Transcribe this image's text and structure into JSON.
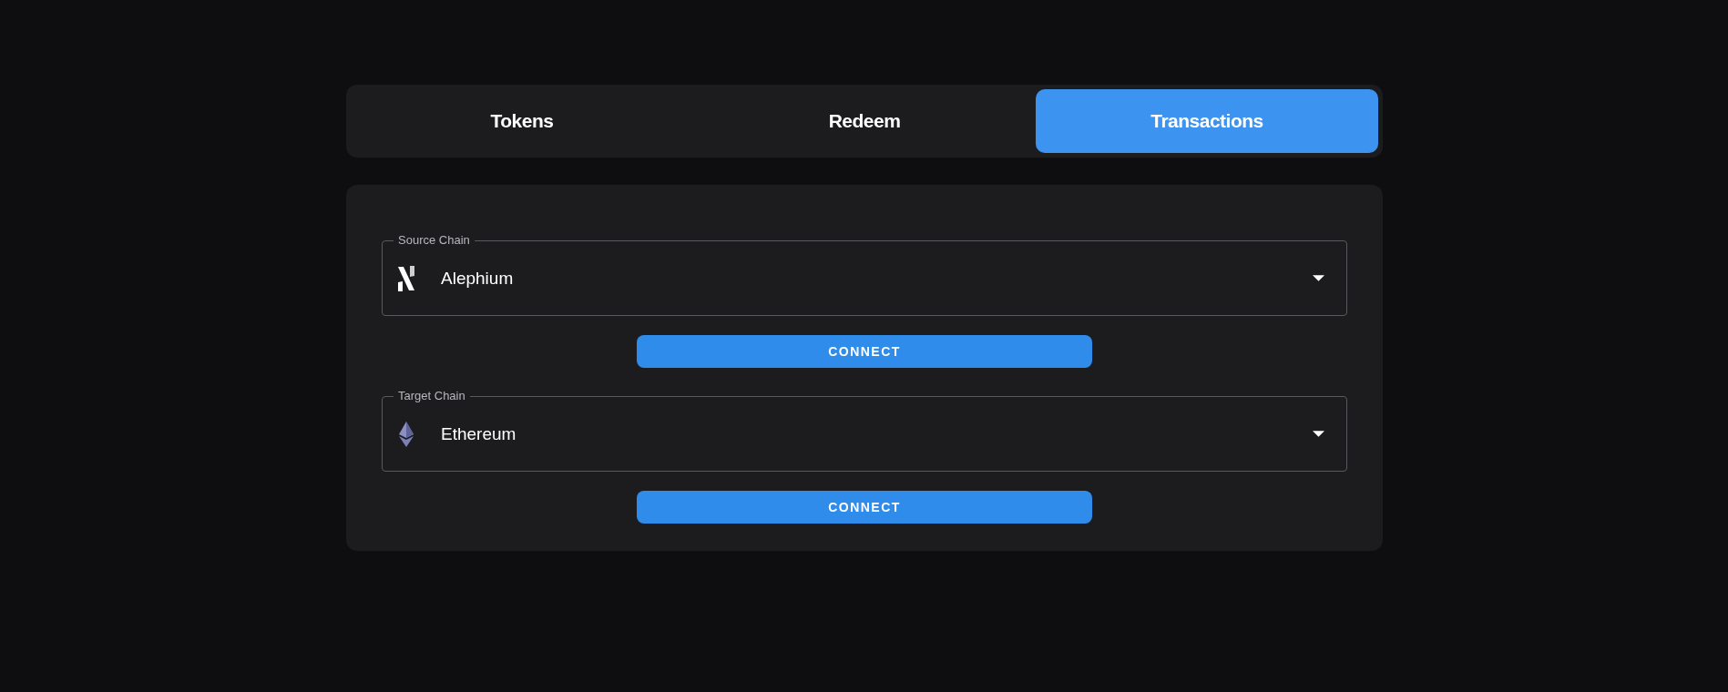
{
  "tabs": [
    {
      "label": "Tokens",
      "selected": false
    },
    {
      "label": "Redeem",
      "selected": false
    },
    {
      "label": "Transactions",
      "selected": true
    }
  ],
  "chains": [
    {
      "label": "Source Chain",
      "kind": "alephium",
      "value": "Alephium",
      "button": "CONNECT"
    },
    {
      "label": "Target Chain",
      "kind": "ethereum",
      "value": "Ethereum",
      "button": "CONNECT"
    }
  ]
}
